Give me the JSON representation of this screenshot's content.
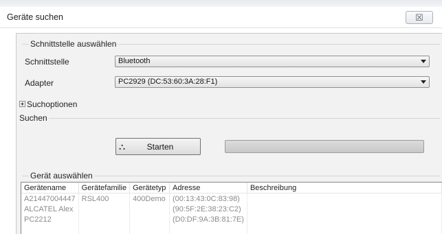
{
  "window": {
    "title": "Geräte suchen",
    "close_glyph": "☒",
    "close_icon": "close-icon"
  },
  "interface_group": {
    "title": "Schnittstelle auswählen",
    "interface_label": "Schnittstelle",
    "interface_value": "Bluetooth",
    "adapter_label": "Adapter",
    "adapter_value": "PC2929 (DC:53:60:3A:28:F1)"
  },
  "search_options": {
    "label": "Suchoptionen",
    "expanded": false
  },
  "search_group": {
    "title": "Suchen",
    "start_label": "Starten",
    "start_icon": "binoculars-icon",
    "progress": 0
  },
  "device_group": {
    "title": "Gerät auswählen",
    "columns": [
      "Gerätename",
      "Gerätefamilie",
      "Gerätetyp",
      "Adresse",
      "Beschreibung"
    ],
    "rows": [
      [
        "A21447004447",
        "RSL400",
        "400Demo",
        "(00:13:43:0C:83:98)",
        ""
      ],
      [
        "ALCATEL Alex",
        "",
        "",
        "(90:5F:2E:38:23:C2)",
        ""
      ],
      [
        "PC2212",
        "",
        "",
        "(D0:DF:9A:3B:81:7E)",
        ""
      ]
    ]
  }
}
